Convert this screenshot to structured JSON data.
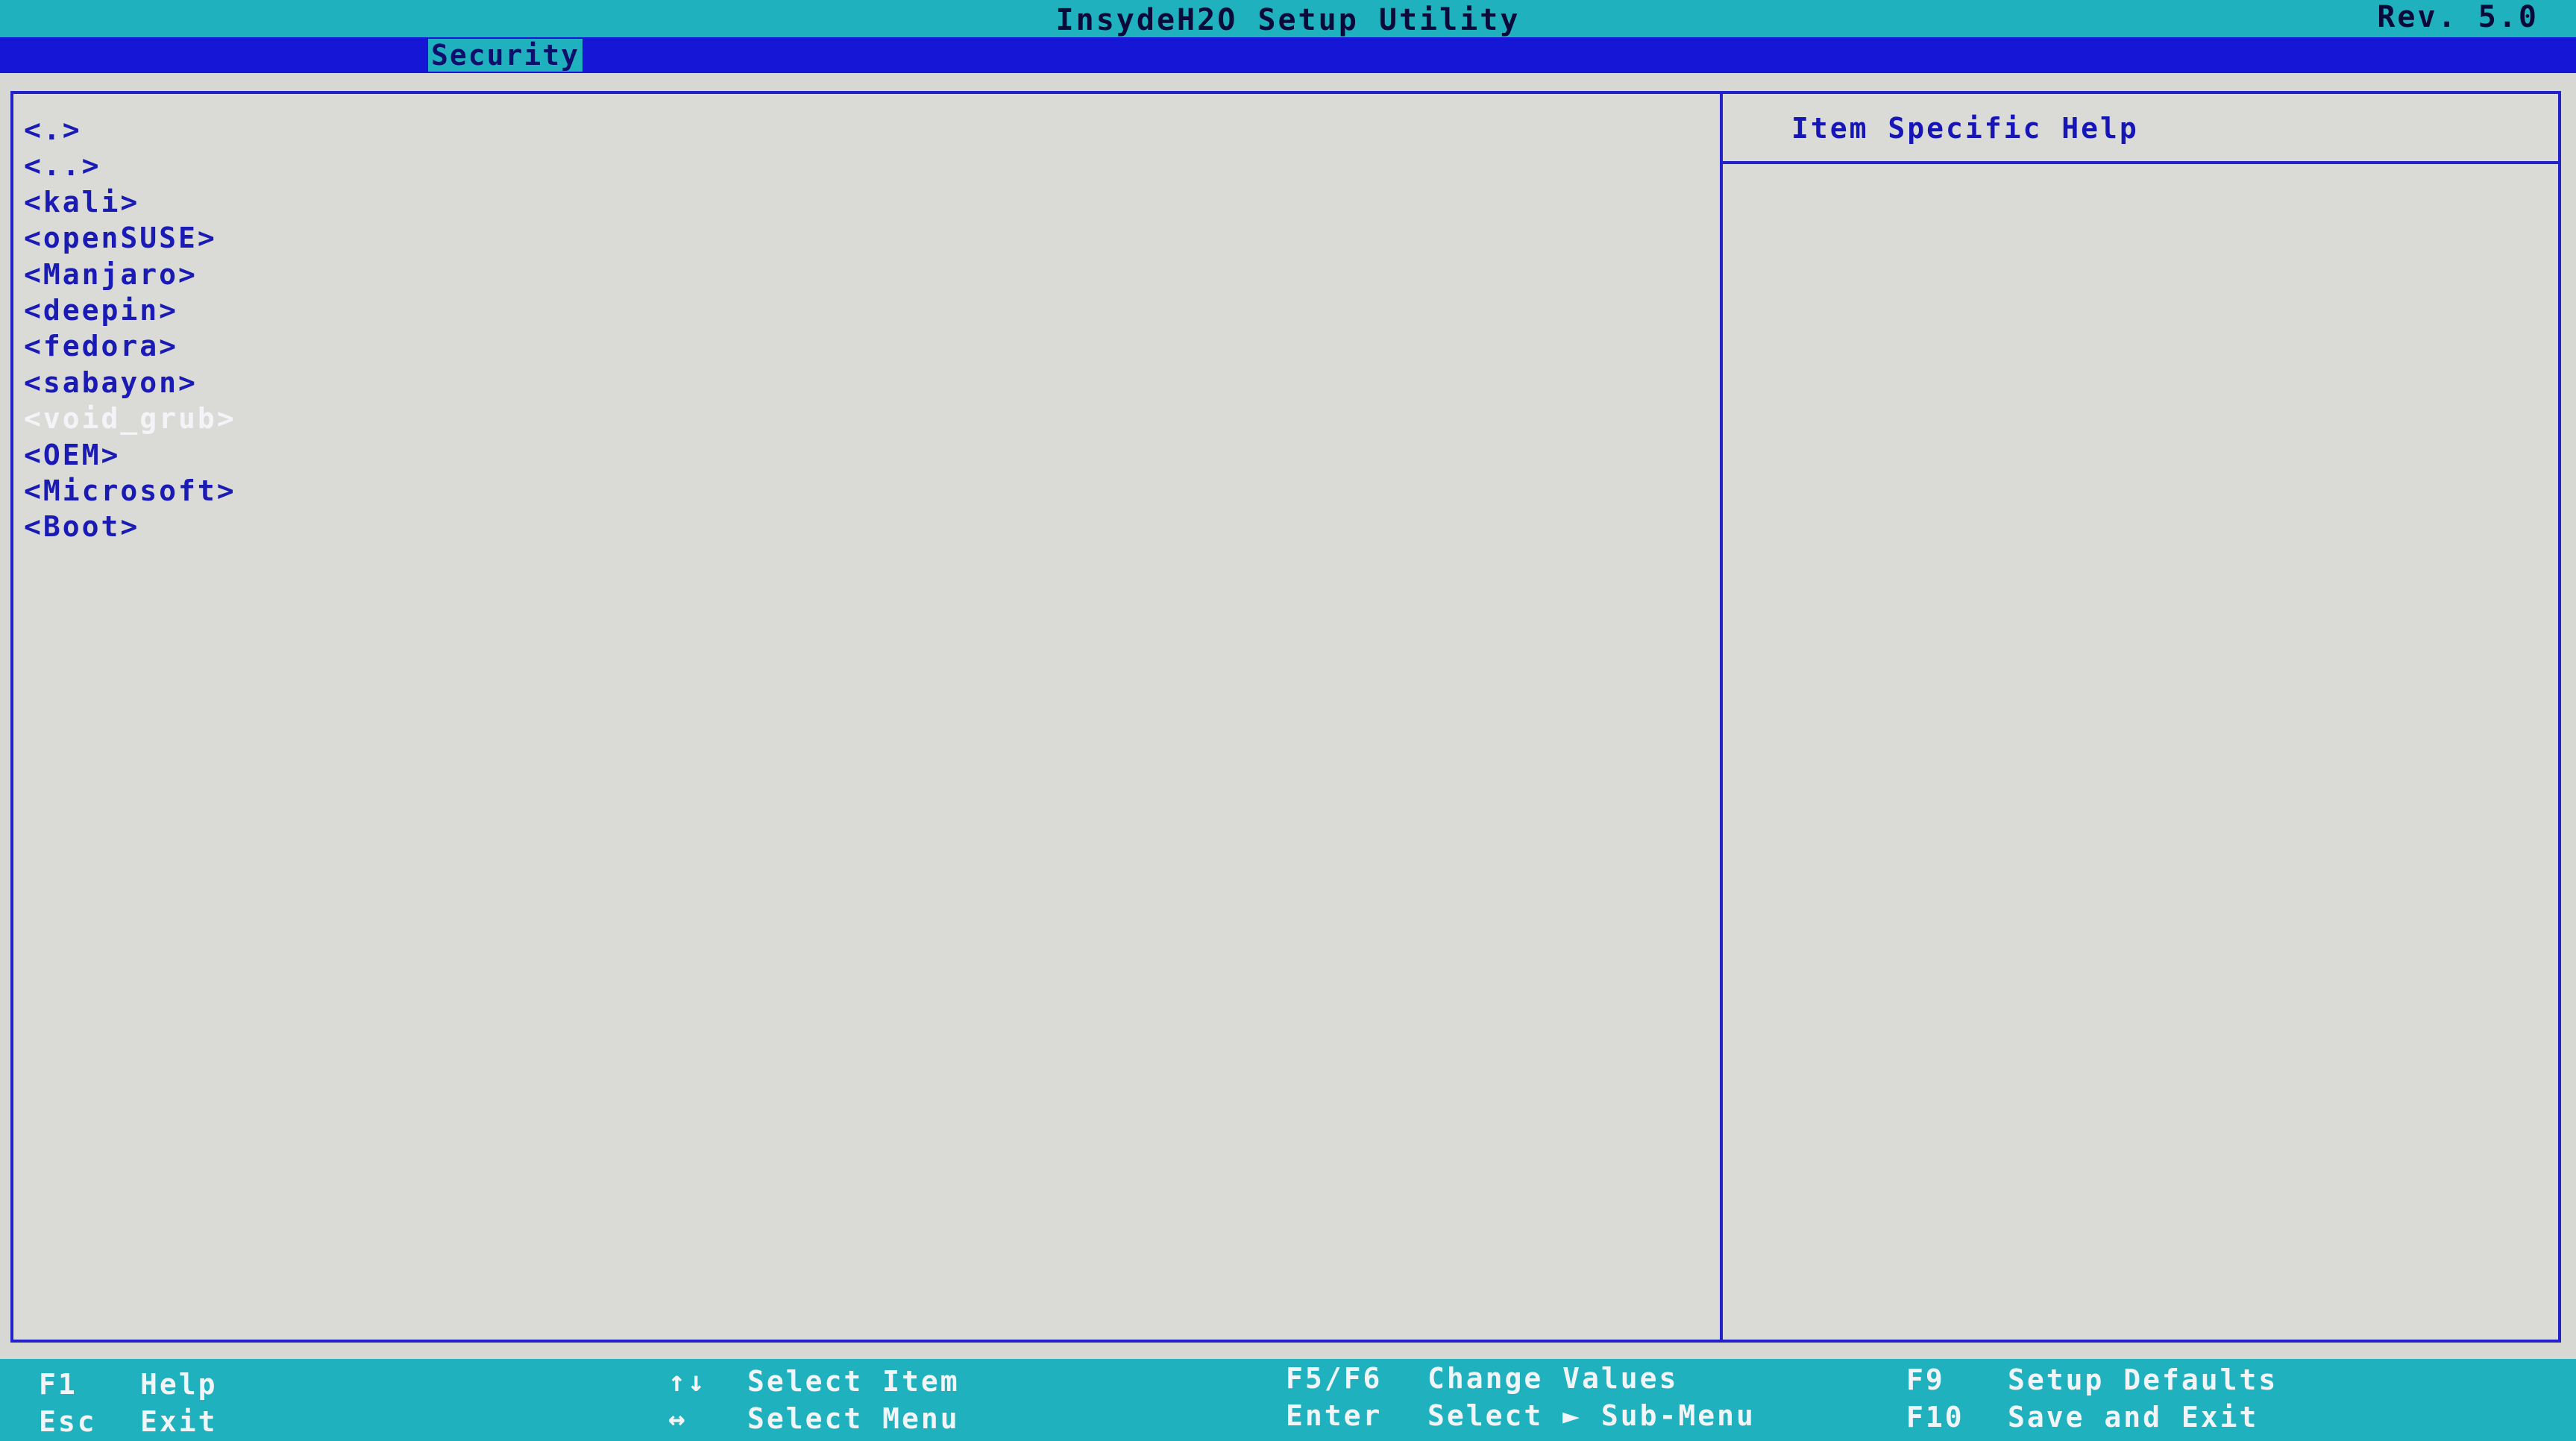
{
  "titlebar": {
    "title": "InsydeH2O Setup Utility",
    "rev": "Rev. 5.0"
  },
  "menubar": {
    "active_tab": "Security"
  },
  "file_browser": {
    "items": [
      {
        "label": "<.>"
      },
      {
        "label": "<..>"
      },
      {
        "label": "<kali>"
      },
      {
        "label": "<openSUSE>"
      },
      {
        "label": "<Manjaro>"
      },
      {
        "label": "<deepin>"
      },
      {
        "label": "<fedora>"
      },
      {
        "label": "<sabayon>"
      },
      {
        "label": "<void_grub>"
      },
      {
        "label": "<OEM>"
      },
      {
        "label": "<Microsoft>"
      },
      {
        "label": "<Boot>"
      }
    ],
    "selected_index": 8
  },
  "help_panel": {
    "title": "Item Specific Help"
  },
  "footer": {
    "f1_key": "F1",
    "f1_label": "Help",
    "esc_key": "Esc",
    "esc_label": "Exit",
    "updown_key": "↑↓",
    "updown_label": "Select Item",
    "leftright_key": "↔",
    "leftright_label": "Select Menu",
    "f5f6_key": "F5/F6",
    "f5f6_label": "Change Values",
    "enter_key": "Enter",
    "enter_label": "Select ► Sub-Menu",
    "f9_key": "F9",
    "f9_label": "Setup Defaults",
    "f10_key": "F10",
    "f10_label": "Save and Exit"
  },
  "colors": {
    "title_bar": "#1fb1bd",
    "menu_bar": "#1616d6",
    "item_text": "#1a1ab4",
    "selected_text": "#f4f4f8",
    "panel_bg": "#dadbd7"
  }
}
